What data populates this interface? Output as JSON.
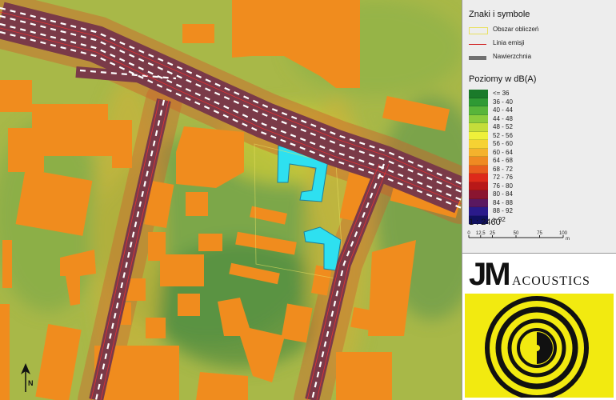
{
  "legend": {
    "symbols_title": "Znaki i symbole",
    "symbols": [
      {
        "label": "Obszar obliczeń",
        "color": "#e8e060",
        "style": "outline"
      },
      {
        "label": "Linia emisji",
        "color": "#d02020",
        "style": "line"
      },
      {
        "label": "Nawierzchnia",
        "color": "#707070",
        "style": "thick"
      }
    ],
    "levels_title": "Poziomy w dB(A)",
    "levels": [
      {
        "label": "<= 36",
        "color": "#1a7a2a"
      },
      {
        "label": "36 - 40",
        "color": "#2f9a34"
      },
      {
        "label": "40 - 44",
        "color": "#58b53a"
      },
      {
        "label": "44 - 48",
        "color": "#8ccc3c"
      },
      {
        "label": "48 - 52",
        "color": "#c4dd3a"
      },
      {
        "label": "52 - 56",
        "color": "#eef03a"
      },
      {
        "label": "56 - 60",
        "color": "#f6d233"
      },
      {
        "label": "60 - 64",
        "color": "#f4b22c"
      },
      {
        "label": "64 - 68",
        "color": "#ef8a22"
      },
      {
        "label": "68 - 72",
        "color": "#e85d1e"
      },
      {
        "label": "72 - 76",
        "color": "#dd2a1a"
      },
      {
        "label": "76 - 80",
        "color": "#b81818"
      },
      {
        "label": "80 - 84",
        "color": "#8a1530"
      },
      {
        "label": "84 - 88",
        "color": "#5a1860"
      },
      {
        "label": "88 - 92",
        "color": "#2a1a8a"
      },
      {
        "label": "> 92",
        "color": "#101060"
      }
    ],
    "scale": "1 : 2460",
    "scale_ticks": [
      "0",
      "12,5",
      "25",
      "50",
      "75",
      "100"
    ],
    "scale_unit": "m"
  },
  "logo": {
    "initials": "JM",
    "name": "ACOUSTICS",
    "bg_color": "#f2ea10"
  },
  "map": {
    "north_label": "N",
    "building_color": "#f08c1e",
    "highlight_color": "#2ee0f0"
  }
}
